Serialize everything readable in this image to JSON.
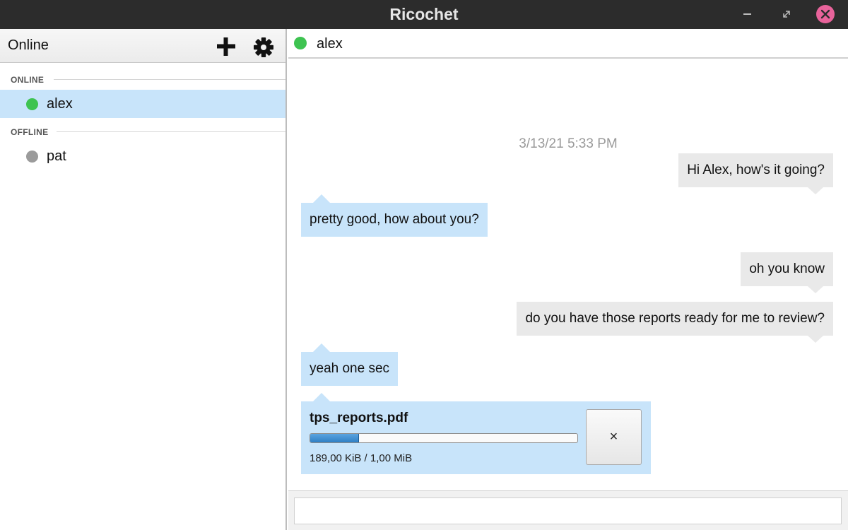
{
  "window": {
    "title": "Ricochet"
  },
  "sidebar": {
    "status_label": "Online",
    "sections": [
      {
        "title": "ONLINE",
        "contacts": [
          {
            "name": "alex",
            "status_color": "#3ec351",
            "selected": true
          }
        ]
      },
      {
        "title": "OFFLINE",
        "contacts": [
          {
            "name": "pat",
            "status_color": "#9b9b9b",
            "selected": false
          }
        ]
      }
    ]
  },
  "chat": {
    "contact_name": "alex",
    "contact_status_color": "#3ec351",
    "timestamp": "3/13/21 5:33 PM",
    "messages": [
      {
        "direction": "out",
        "text": "Hi Alex, how's it going?"
      },
      {
        "direction": "in",
        "text": "pretty good, how about you?"
      },
      {
        "direction": "out",
        "text": "oh you know"
      },
      {
        "direction": "out",
        "text": "do you have those reports ready for me to review?"
      },
      {
        "direction": "in",
        "text": "yeah one sec"
      }
    ],
    "file_transfer": {
      "filename": "tps_reports.pdf",
      "progress_fraction": 0.18,
      "size_text": "189,00 KiB / 1,00 MiB",
      "cancel_label": "×"
    },
    "composer": {
      "value": "",
      "placeholder": ""
    }
  },
  "colors": {
    "online": "#3ec351",
    "offline": "#9b9b9b",
    "incoming_bubble": "#c8e4fa",
    "outgoing_bubble": "#e9e9e9",
    "selection": "#c8e4fa"
  }
}
